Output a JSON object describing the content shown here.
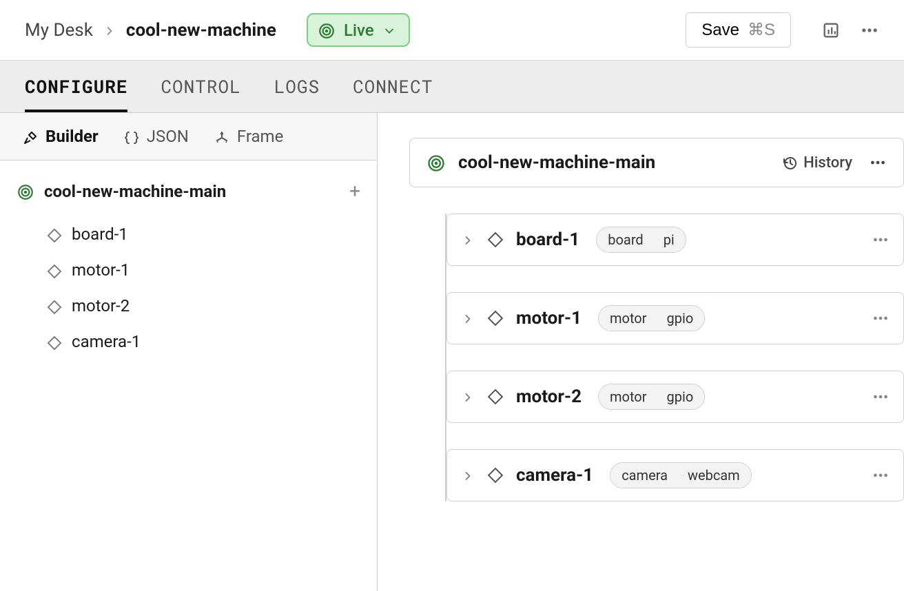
{
  "breadcrumb": {
    "parent": "My Desk",
    "current": "cool-new-machine"
  },
  "status": {
    "label": "Live"
  },
  "actions": {
    "save": "Save",
    "shortcut": "⌘S"
  },
  "tabs": [
    "CONFIGURE",
    "CONTROL",
    "LOGS",
    "CONNECT"
  ],
  "activeTab": 0,
  "subtabs": [
    {
      "label": "Builder",
      "icon": "tools-icon"
    },
    {
      "label": "JSON",
      "icon": "braces-icon"
    },
    {
      "label": "Frame",
      "icon": "axes-icon"
    }
  ],
  "activeSubtab": 0,
  "tree": {
    "root": "cool-new-machine-main",
    "items": [
      "board-1",
      "motor-1",
      "motor-2",
      "camera-1"
    ]
  },
  "partHeader": {
    "name": "cool-new-machine-main",
    "historyLabel": "History"
  },
  "components": [
    {
      "name": "board-1",
      "type": "board",
      "model": "pi"
    },
    {
      "name": "motor-1",
      "type": "motor",
      "model": "gpio"
    },
    {
      "name": "motor-2",
      "type": "motor",
      "model": "gpio"
    },
    {
      "name": "camera-1",
      "type": "camera",
      "model": "webcam"
    }
  ]
}
